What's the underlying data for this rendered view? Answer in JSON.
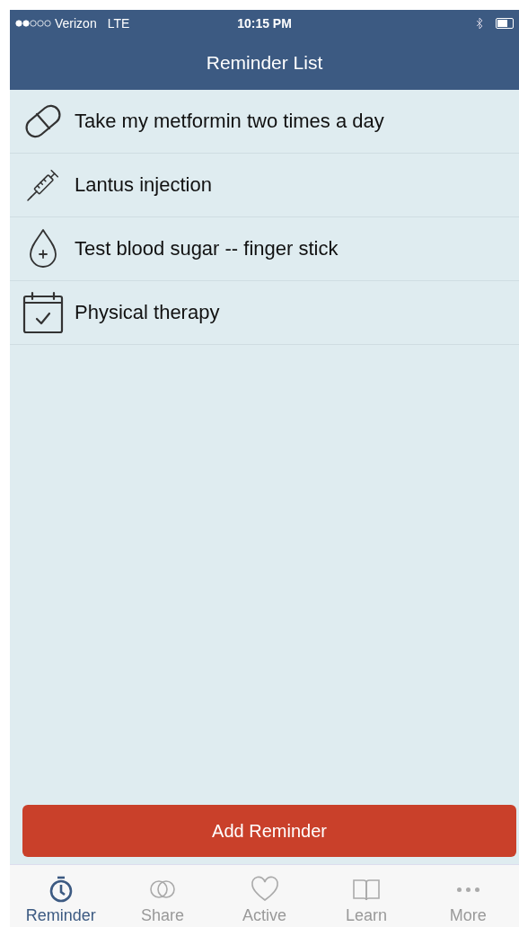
{
  "status_bar": {
    "carrier": "Verizon",
    "network": "LTE",
    "time": "10:15 PM"
  },
  "nav_bar": {
    "title": "Reminder List"
  },
  "reminders": [
    {
      "kind": "pill",
      "text": "Take my metformin two times a day"
    },
    {
      "kind": "syringe",
      "text": "Lantus injection"
    },
    {
      "kind": "drop",
      "text": "Test blood sugar -- finger stick"
    },
    {
      "kind": "calendar",
      "text": "Physical therapy"
    }
  ],
  "add_button": {
    "label": "Add Reminder"
  },
  "tab_bar": [
    {
      "kind": "timer",
      "label": "Reminder",
      "selected": true
    },
    {
      "kind": "rings",
      "label": "Share",
      "selected": false
    },
    {
      "kind": "heart",
      "label": "Active",
      "selected": false
    },
    {
      "kind": "book",
      "label": "Learn",
      "selected": false
    },
    {
      "kind": "dots",
      "label": "More",
      "selected": false
    }
  ]
}
